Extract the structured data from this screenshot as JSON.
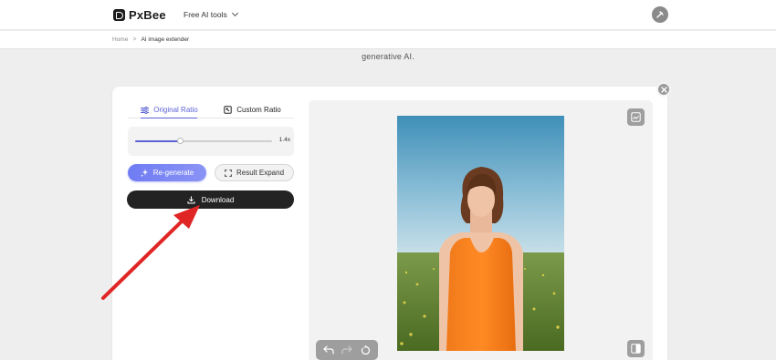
{
  "header": {
    "logo_text": "PxBee",
    "tools_menu_label": "Free AI tools"
  },
  "breadcrumb": {
    "home": "Home",
    "separator": ">",
    "current": "AI image extender"
  },
  "intro_text_fragment": "generative AI.",
  "panel": {
    "tabs": [
      {
        "label": "Original Ratio",
        "active": true,
        "icon": "sliders-icon"
      },
      {
        "label": "Custom Ratio",
        "active": false,
        "icon": "crop-icon"
      }
    ],
    "slider": {
      "value_label": "1.4x",
      "fill_fraction": 0.33
    },
    "regenerate_label": "Re-generate",
    "result_expand_label": "Result Expand",
    "download_label": "Download"
  },
  "colors": {
    "accent": "#5b63d3",
    "download_bg": "#232323",
    "annotation_arrow": "#e02525"
  },
  "icons": {
    "close": "close-icon",
    "compare": "compare-icon",
    "edit_image": "edit-image-icon",
    "undo": "undo-icon",
    "redo": "redo-icon",
    "reset": "reset-icon",
    "user": "user-avatar-icon"
  }
}
